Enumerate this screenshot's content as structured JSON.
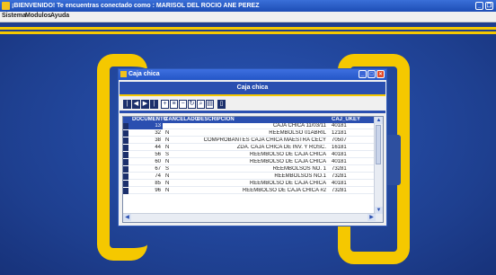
{
  "window": {
    "title": "¡BIENVENIDO! Te encuentras conectado como : MARISOL DEL ROCIO ANE PEREZ"
  },
  "menu": [
    "Sistema",
    "Modulos",
    "Ayuda"
  ],
  "child": {
    "title": "Caja chica",
    "header": "Caja chica"
  },
  "toolbar": {
    "buttons": [
      {
        "name": "first-record",
        "glyph": "|◀"
      },
      {
        "name": "prev-record",
        "glyph": "◀"
      },
      {
        "name": "next-record",
        "glyph": "▶"
      },
      {
        "name": "last-record",
        "glyph": "▶|"
      },
      {
        "name": "add-record",
        "glyph": "+"
      },
      {
        "name": "edit-record",
        "glyph": "≡"
      },
      {
        "name": "delete-record",
        "glyph": "−"
      },
      {
        "name": "refresh",
        "glyph": "↻"
      },
      {
        "name": "search",
        "glyph": "⌕"
      },
      {
        "name": "print",
        "glyph": "▤"
      },
      {
        "name": "exit",
        "glyph": "▯"
      }
    ]
  },
  "grid": {
    "headers": {
      "doc": "DOCUMENTO",
      "can": "CANCELADO",
      "des": "DESCRIPCION",
      "caj": "CAJ_UKEY"
    },
    "rows": [
      {
        "doc": "13",
        "can": "",
        "des": "CAJA CHICA 11/03/11",
        "caj": "40181"
      },
      {
        "doc": "32",
        "can": "N",
        "des": "REEMBOLSO 01ABRIL",
        "caj": "12181"
      },
      {
        "doc": "38",
        "can": "N",
        "des": "COMPROBANTES CAJA CHICA MAESTRA CECY",
        "caj": "70507"
      },
      {
        "doc": "44",
        "can": "N",
        "des": "ZDA. CAJA CHICA DE INV. Y ROSC.",
        "caj": "16181"
      },
      {
        "doc": "56",
        "can": "S",
        "des": "REEMBOLSO DE CAJA CHICA",
        "caj": "40181"
      },
      {
        "doc": "60",
        "can": "N",
        "des": "REEMBOLSO DE CAJA CHICA",
        "caj": "40181"
      },
      {
        "doc": "67",
        "can": "S",
        "des": "REEMBOLSOS NO. 1",
        "caj": "73281"
      },
      {
        "doc": "74",
        "can": "N",
        "des": "REEMBOLSOS NO.1",
        "caj": "73281"
      },
      {
        "doc": "85",
        "can": "N",
        "des": "REEMBOLSO DE CAJA CHICA",
        "caj": "40181"
      },
      {
        "doc": "96",
        "can": "N",
        "des": "REEMBOLSO DE CAJA CHICA #2",
        "caj": "73281"
      }
    ]
  }
}
